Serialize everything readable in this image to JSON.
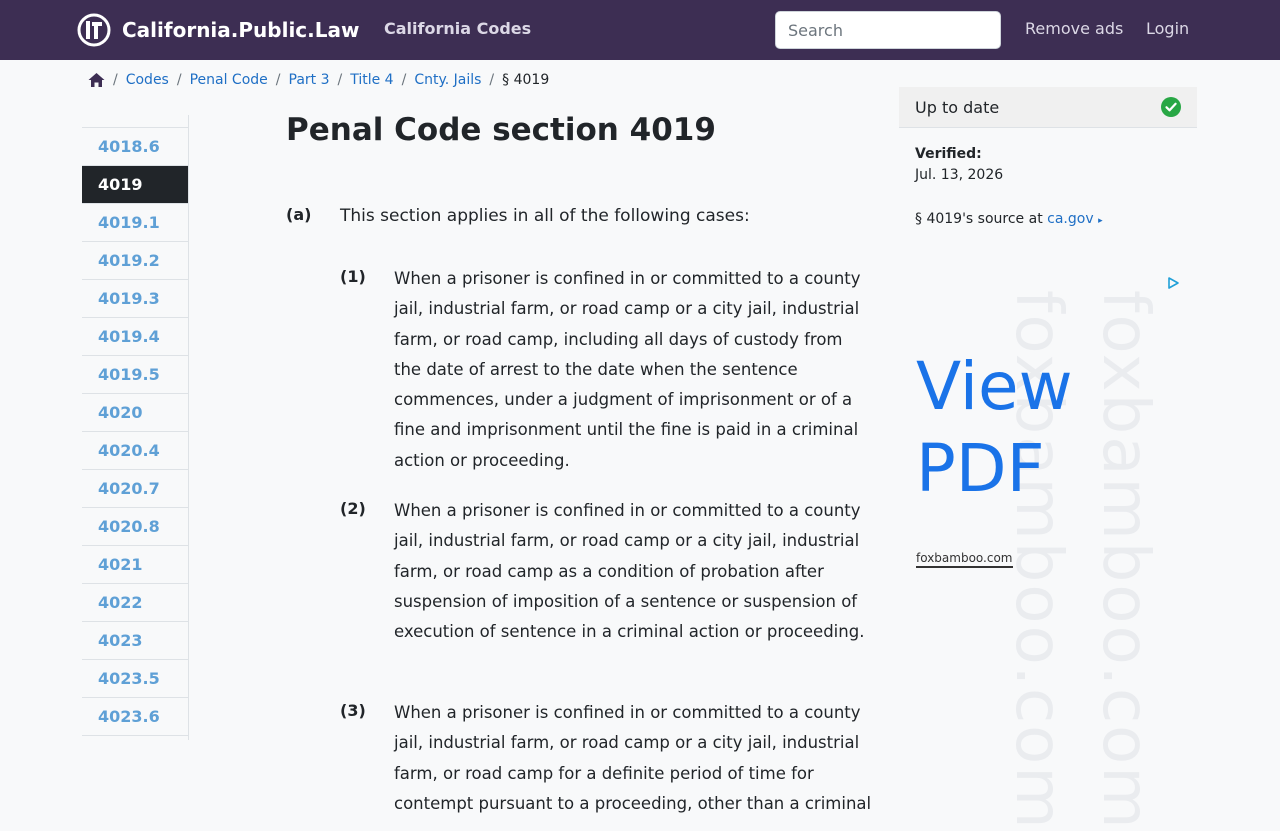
{
  "header": {
    "site_name": "California.Public.Law",
    "nav_codes": "California Codes",
    "search_placeholder": "Search",
    "remove_ads": "Remove ads",
    "login": "Login"
  },
  "breadcrumb": {
    "items": [
      "Codes",
      "Penal Code",
      "Part 3",
      "Title 4",
      "Cnty. Jails"
    ],
    "current": "§ 4019"
  },
  "section_nav": {
    "items": [
      "4018.6",
      "4019",
      "4019.1",
      "4019.2",
      "4019.3",
      "4019.4",
      "4019.5",
      "4020",
      "4020.4",
      "4020.7",
      "4020.8",
      "4021",
      "4022",
      "4023",
      "4023.5",
      "4023.6"
    ],
    "active": "4019"
  },
  "main": {
    "title": "Penal Code section 4019",
    "para_a": {
      "num": "(a)",
      "text": "This section applies in all of the following cases:"
    },
    "subparas": [
      {
        "num": "(1)",
        "text": "When a prisoner is confined in or committed to a county jail, industrial farm, or road camp or a city jail, industrial farm, or road camp, including all days of custody from the date of arrest to the date when the sentence commences, under a judgment of imprisonment or of a fine and imprisonment until the fine is paid in a criminal action or proceeding."
      },
      {
        "num": "(2)",
        "text": "When a prisoner is confined in or committed to a county jail, industrial farm, or road camp or a city jail, industrial farm, or road camp as a condition of probation after suspension of imposition of a sentence or suspension of execution of sentence in a criminal action or proceeding."
      },
      {
        "num": "(3)",
        "text": "When a prisoner is confined in or committed to a county jail, industrial farm, or road camp or a city jail, industrial farm, or road camp for a definite period of time for contempt pursuant to a proceeding, other than a criminal"
      }
    ]
  },
  "sidebar": {
    "status": "Up to date",
    "verified_label": "Verified:",
    "verified_date": "Jul. 13, 2026",
    "source_prefix": "§ 4019's source at",
    "source_link": "ca.gov",
    "source_arrow": "▸"
  },
  "ad": {
    "headline_line1": "View",
    "headline_line2": "PDF",
    "domain": "foxbamboo.com",
    "watermark_1": "foxbamboo.com",
    "watermark_2": "foxbamboo.com"
  },
  "colors": {
    "navbar": "#3d2e53",
    "link": "#1f6fc5",
    "secnav_link": "#5fa0d6",
    "status_check": "#28a745",
    "ad_headline": "#1a73e8"
  }
}
